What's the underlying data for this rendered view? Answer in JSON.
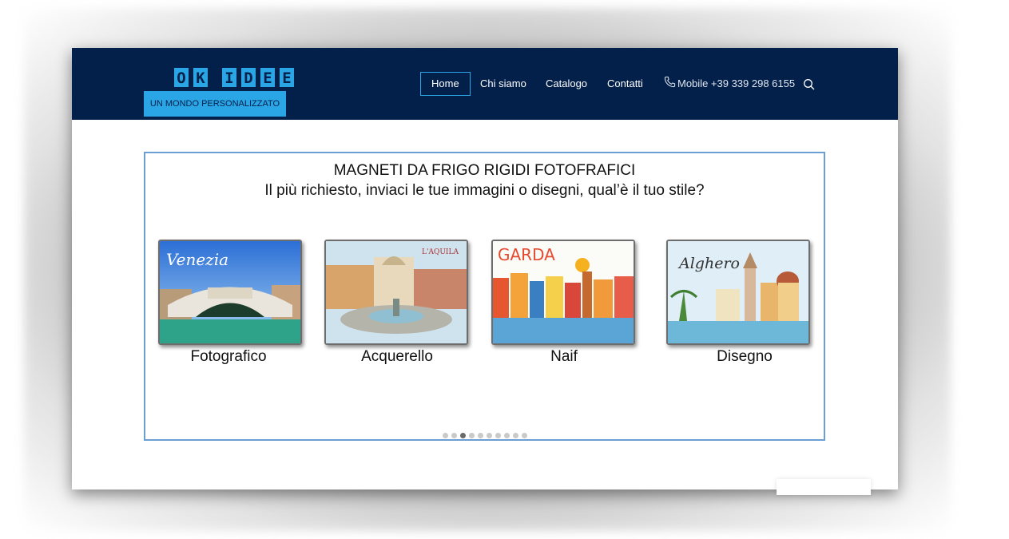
{
  "header": {
    "logo": {
      "top_letters": [
        "O",
        "K",
        "I",
        "D",
        "E",
        "E"
      ],
      "tagline": "UN MONDO PERSONALIZZATO"
    },
    "nav": [
      {
        "label": "Home",
        "active": true
      },
      {
        "label": "Chi siamo",
        "active": false
      },
      {
        "label": "Catalogo",
        "active": false
      },
      {
        "label": "Contatti",
        "active": false
      }
    ],
    "phone": {
      "label": "Mobile +39 339 298 6155",
      "icon": "phone-icon"
    },
    "search_icon": "search-icon"
  },
  "slider": {
    "title": "MAGNETI DA FRIGO RIGIDI FOTOFRAFICI",
    "subtitle": "Il più richiesto, inviaci le tue immagini o disegni, qual’è il tuo stile?",
    "magnets": [
      {
        "label": "Fotografico",
        "caption": "Venezia"
      },
      {
        "label": "Acquerello",
        "caption": "L'AQUILA"
      },
      {
        "label": "Naif",
        "caption": "GARDA"
      },
      {
        "label": "Disegno",
        "caption": "Alghero"
      }
    ],
    "dots_total": 10,
    "dot_active_index": 2
  },
  "colors": {
    "header_bg": "#03204a",
    "accent": "#2aa6e6",
    "frame_border": "#6a9fd4"
  }
}
